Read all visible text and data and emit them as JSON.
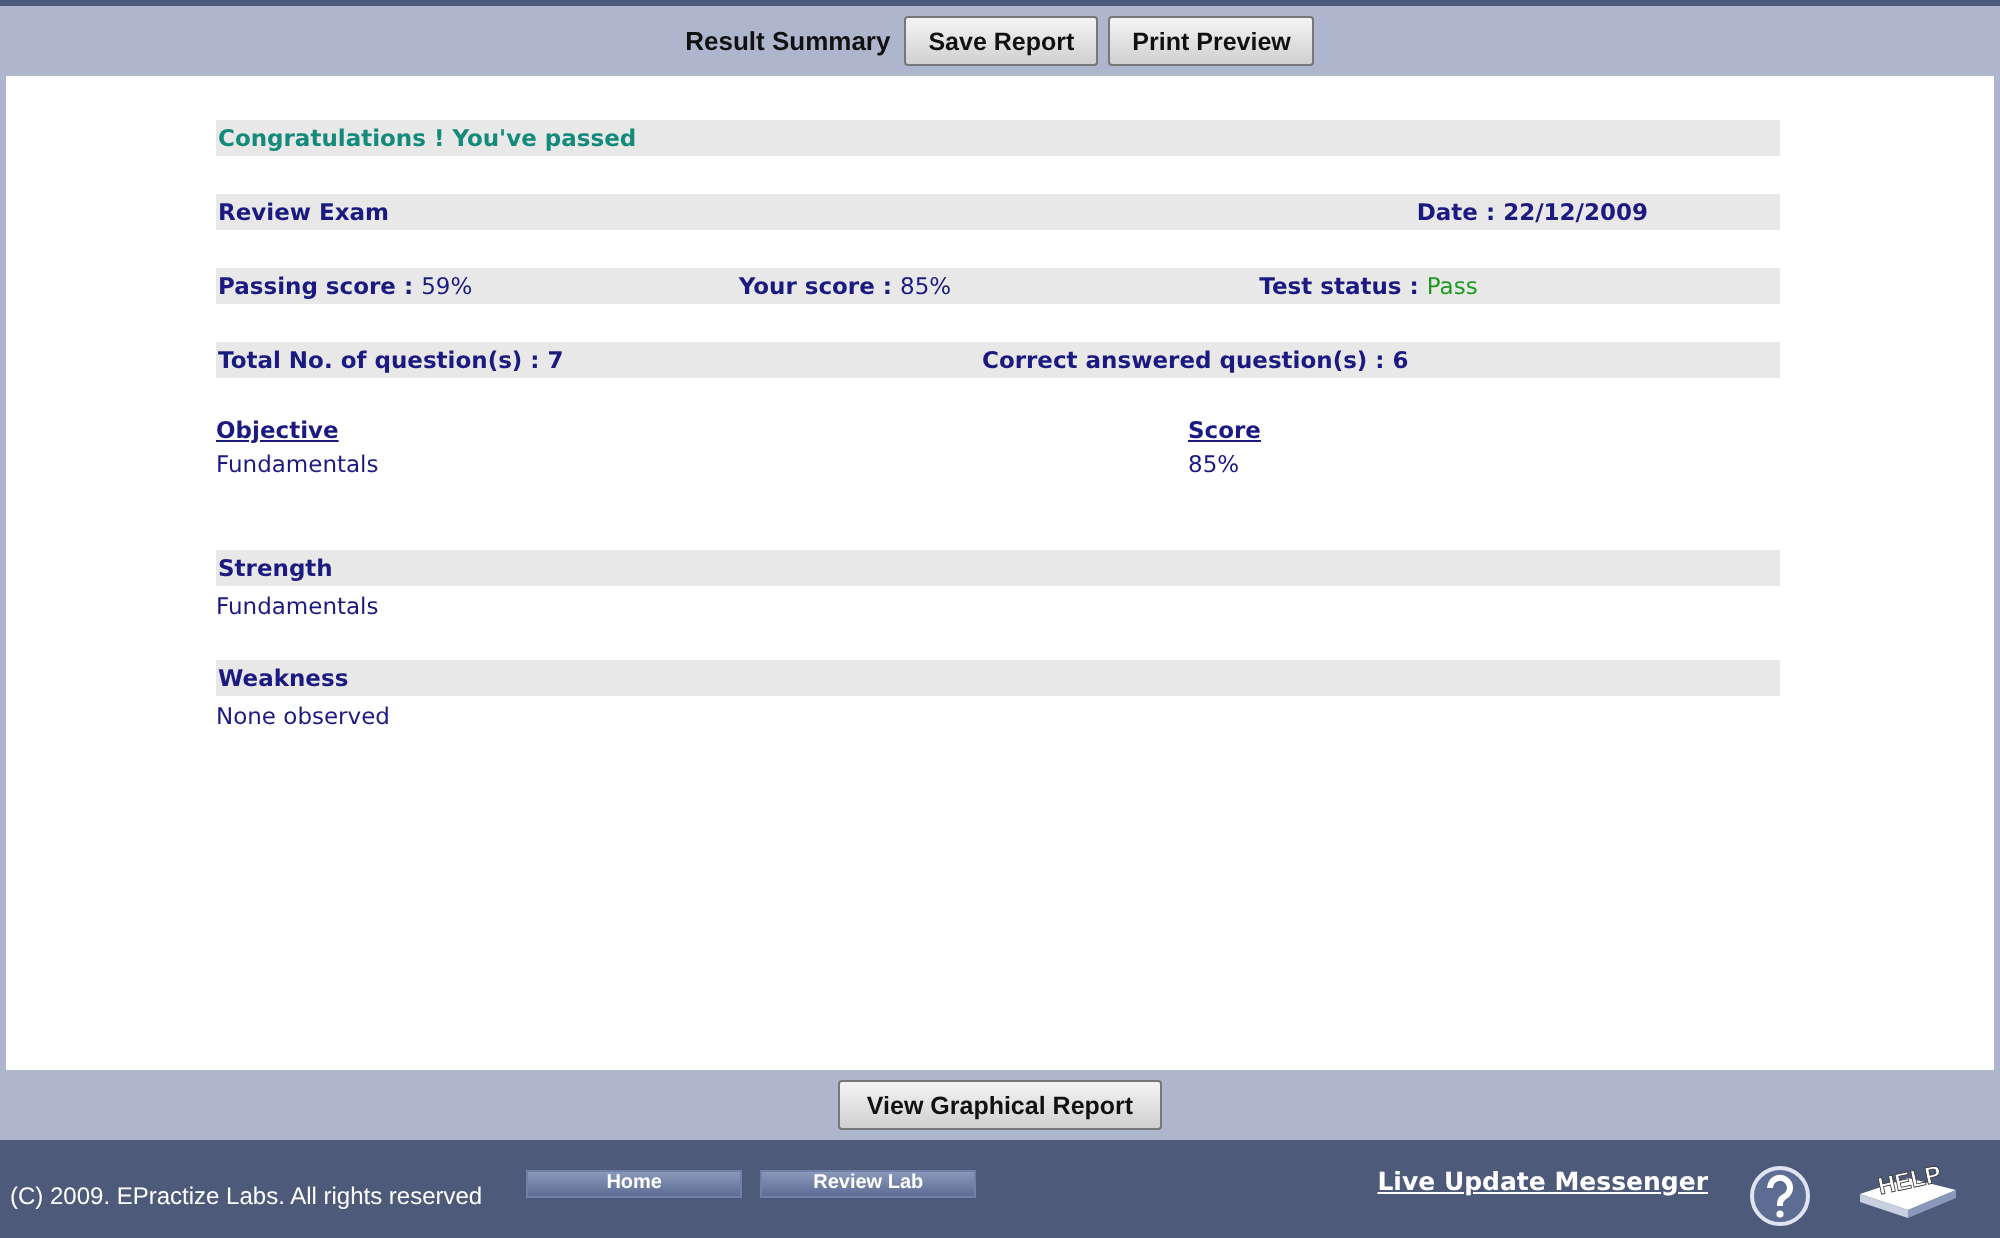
{
  "toolbar": {
    "title": "Result Summary",
    "buttons": [
      "Save Report",
      "Print Preview"
    ]
  },
  "message": "Congratulations ! You've passed",
  "exam": {
    "name": "Review Exam",
    "date_label": "Date :",
    "date": "22/12/2009"
  },
  "scores": [
    {
      "label": "Passing score :",
      "value": "59%",
      "kind": "plain"
    },
    {
      "label": "Your score :",
      "value": "85%",
      "kind": "plain"
    },
    {
      "label": "Test status :",
      "value": "Pass",
      "kind": "status"
    }
  ],
  "counts": [
    {
      "label": "Total No. of question(s) :",
      "value": "7"
    },
    {
      "label": "Correct answered question(s) :",
      "value": "6"
    }
  ],
  "objectives": {
    "columns": [
      "Objective ",
      "Score"
    ],
    "rows": [
      [
        "Fundamentals",
        "85%"
      ]
    ]
  },
  "sections": [
    {
      "title": "Strength",
      "text": "Fundamentals"
    },
    {
      "title": "Weakness",
      "text": "None observed"
    }
  ],
  "bottom_button": "View Graphical Report",
  "footer": {
    "copyright": "(C) 2009. EPractize Labs. All rights reserved",
    "nav": [
      "Home",
      "Review Lab"
    ],
    "link": "Live Update Messenger",
    "help_label": "HELP"
  }
}
